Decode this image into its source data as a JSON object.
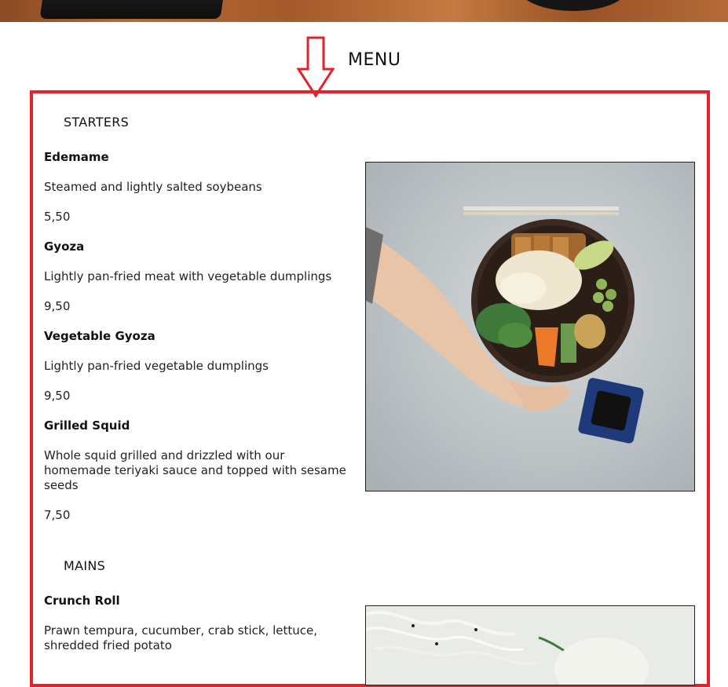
{
  "page": {
    "menu_title": "MENU"
  },
  "sections": [
    {
      "title": "STARTERS",
      "items": [
        {
          "name": "Edemame",
          "description": "Steamed and lightly salted soybeans",
          "price": "5,50"
        },
        {
          "name": "Gyoza",
          "description": "Lightly pan-fried meat with vegetable dumplings",
          "price": "9,50"
        },
        {
          "name": "Vegetable Gyoza",
          "description": "Lightly pan-fried vegetable dumplings",
          "price": "9,50"
        },
        {
          "name": "Grilled Squid",
          "description": "Whole squid grilled and drizzled with our homemade teriyaki sauce and topped with sesame seeds",
          "price": "7,50"
        }
      ]
    },
    {
      "title": "MAINS",
      "items": [
        {
          "name": "Crunch Roll",
          "description": "Prawn tempura, cucumber, crab stick, lettuce, shredded fried potato"
        }
      ]
    }
  ],
  "colors": {
    "highlight": "#e5212b",
    "text": "#111111"
  },
  "icons": {
    "arrow": "down-arrow-icon"
  }
}
